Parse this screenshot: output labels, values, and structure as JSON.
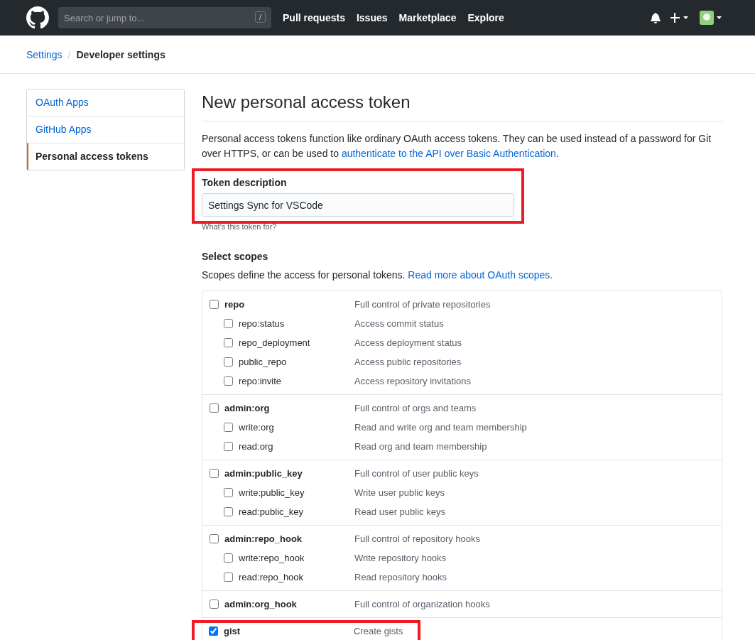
{
  "header": {
    "search": {
      "placeholder": "Search or jump to...",
      "shortcut": "/"
    },
    "nav": [
      "Pull requests",
      "Issues",
      "Marketplace",
      "Explore"
    ]
  },
  "breadcrumb": {
    "parent": "Settings",
    "separator": "/",
    "current": "Developer settings"
  },
  "sidebar": {
    "items": [
      {
        "label": "OAuth Apps",
        "selected": false
      },
      {
        "label": "GitHub Apps",
        "selected": false
      },
      {
        "label": "Personal access tokens",
        "selected": true
      }
    ]
  },
  "main": {
    "title": "New personal access token",
    "intro": {
      "text_before": "Personal access tokens function like ordinary OAuth access tokens. They can be used instead of a password for Git over HTTPS, or can be used to ",
      "link": "authenticate to the API over Basic Authentication",
      "text_after": "."
    },
    "token_description": {
      "label": "Token description",
      "value": "Settings Sync for VSCode",
      "note": "What's this token for?",
      "highlighted": true
    },
    "scopes": {
      "title": "Select scopes",
      "text": "Scopes define the access for personal tokens. ",
      "link": "Read more about OAuth scopes.",
      "groups": [
        {
          "name": "repo",
          "description": "Full control of private repositories",
          "checked": false,
          "highlighted": false,
          "children": [
            {
              "name": "repo:status",
              "description": "Access commit status",
              "checked": false
            },
            {
              "name": "repo_deployment",
              "description": "Access deployment status",
              "checked": false
            },
            {
              "name": "public_repo",
              "description": "Access public repositories",
              "checked": false
            },
            {
              "name": "repo:invite",
              "description": "Access repository invitations",
              "checked": false
            }
          ]
        },
        {
          "name": "admin:org",
          "description": "Full control of orgs and teams",
          "checked": false,
          "highlighted": false,
          "children": [
            {
              "name": "write:org",
              "description": "Read and write org and team membership",
              "checked": false
            },
            {
              "name": "read:org",
              "description": "Read org and team membership",
              "checked": false
            }
          ]
        },
        {
          "name": "admin:public_key",
          "description": "Full control of user public keys",
          "checked": false,
          "highlighted": false,
          "children": [
            {
              "name": "write:public_key",
              "description": "Write user public keys",
              "checked": false
            },
            {
              "name": "read:public_key",
              "description": "Read user public keys",
              "checked": false
            }
          ]
        },
        {
          "name": "admin:repo_hook",
          "description": "Full control of repository hooks",
          "checked": false,
          "highlighted": false,
          "children": [
            {
              "name": "write:repo_hook",
              "description": "Write repository hooks",
              "checked": false
            },
            {
              "name": "read:repo_hook",
              "description": "Read repository hooks",
              "checked": false
            }
          ]
        },
        {
          "name": "admin:org_hook",
          "description": "Full control of organization hooks",
          "checked": false,
          "highlighted": false
        },
        {
          "name": "gist",
          "description": "Create gists",
          "checked": true,
          "highlighted": true
        }
      ]
    }
  }
}
